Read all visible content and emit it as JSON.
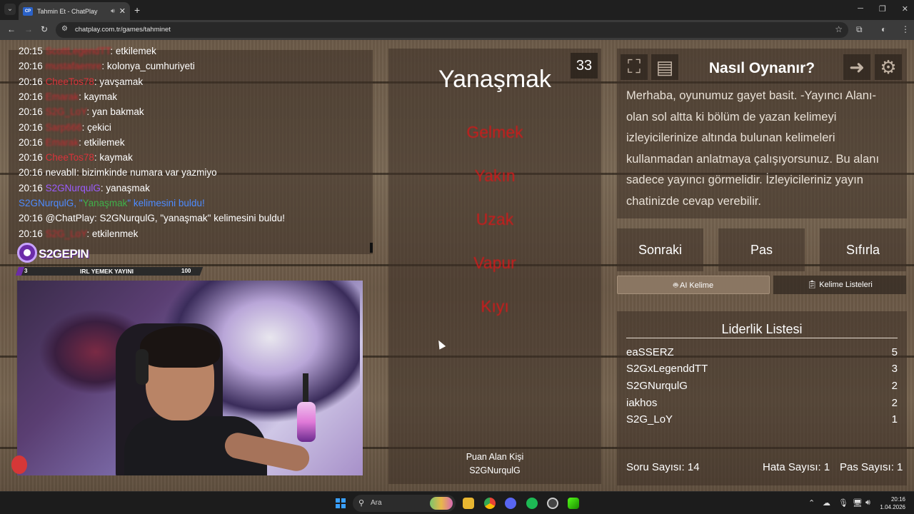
{
  "browser": {
    "tab_title": "Tahmin Et - ChatPlay",
    "favicon_text": "CP",
    "url": "chatplay.com.tr/games/tahminet"
  },
  "chat": {
    "messages": [
      {
        "time": "20:15",
        "user": "ScottLegendTT",
        "user_style": "red-blur",
        "text": ": etkilemek"
      },
      {
        "time": "20:16",
        "user": "mustafaemre",
        "user_style": "red-blur",
        "text": ": kolonya_cumhuriyeti"
      },
      {
        "time": "20:16",
        "user": "CheeTos78",
        "user_style": "red",
        "text": ": yavşamak"
      },
      {
        "time": "20:16",
        "user": "Emarak",
        "user_style": "red-blur",
        "text": ": kaymak"
      },
      {
        "time": "20:16",
        "user": "S2G_LoY",
        "user_style": "red-blur",
        "text": ": yan bakmak"
      },
      {
        "time": "20:16",
        "user": "Sarp666",
        "user_style": "red-blur",
        "text": ": çekici"
      },
      {
        "time": "20:16",
        "user": "Emarak",
        "user_style": "red-blur",
        "text": ": etkilemek"
      },
      {
        "time": "20:16",
        "user": "CheeTos78",
        "user_style": "red",
        "text": ": kaymak"
      },
      {
        "time": "20:16",
        "user": "nevablI",
        "user_style": "white",
        "text": ": bizimkinde numara var yazmiyo"
      },
      {
        "time": "20:16",
        "user": "S2GNurqulG",
        "user_style": "purple",
        "text": ": yanaşmak"
      }
    ],
    "notice": {
      "prefix": "S2GNurqulG, \"",
      "word": "Yanaşmak",
      "suffix": "\" kelimesini buldu!"
    },
    "bot_message": {
      "time": "20:16",
      "text": "@ChatPlay: S2GNurqulG, \"yanaşmak\" kelimesini buldu!"
    },
    "last_message": {
      "time": "20:16",
      "user": "S2G_LoY",
      "text": ": etkilenmek"
    }
  },
  "overlay": {
    "logo_text": "S2GEPIN",
    "goal_current": "3",
    "goal_label": "IRL YEMEK YAYINI",
    "goal_max": "100",
    "goal_progress": 0.03
  },
  "game": {
    "timer": "33",
    "main_word": "Yanaşmak",
    "taboo_words": [
      "Gelmek",
      "Yakın",
      "Uzak",
      "Vapur",
      "Kıyı"
    ],
    "scorer_label": "Puan Alan Kişi",
    "scorer_name": "S2GNurqulG"
  },
  "howto": {
    "title": "Nasıl Oynanır?",
    "text": "Merhaba, oyunumuz gayet basit. -Yayıncı Alanı- olan sol altta ki bölüm de yazan kelimeyi izleyicilerinize altında bulunan kelimeleri kullanmadan anlatmaya çalışıyorsunuz. Bu alanı sadece yayıncı görmelidir. İzleyicileriniz yayın chatinizde cevap verebilir."
  },
  "actions": {
    "next": "Sonraki",
    "pass": "Pas",
    "reset": "Sıfırla"
  },
  "tabs": {
    "ai_word": "AI Kelime",
    "word_lists": "Kelime Listeleri"
  },
  "leaderboard": {
    "title": "Liderlik Listesi",
    "rows": [
      {
        "name": "eaSSERZ",
        "score": "5"
      },
      {
        "name": "S2GxLegenddTT",
        "score": "3"
      },
      {
        "name": "S2GNurqulG",
        "score": "2"
      },
      {
        "name": "iakhos",
        "score": "2"
      },
      {
        "name": "S2G_LoY",
        "score": "1"
      }
    ],
    "question_count": "Soru Sayısı: 14",
    "error_count": "Hata Sayısı: 1",
    "pass_count": "Pas Sayısı: 1"
  },
  "taskbar": {
    "search_placeholder": "Ara",
    "time": "20:16",
    "date": "1.04.2026"
  },
  "colors": {
    "taboo_red": "#cc1b1b",
    "brand_purple": "#6c2ca8",
    "notice_blue": "#4d8bff"
  }
}
